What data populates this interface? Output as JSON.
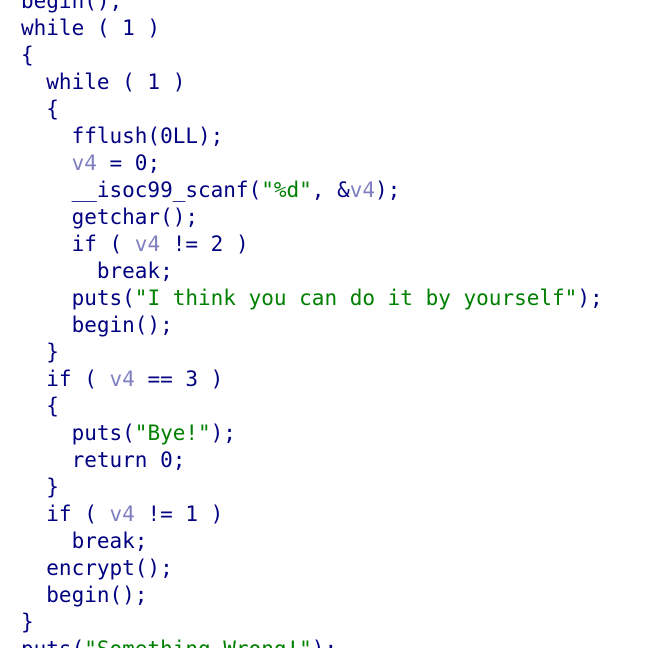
{
  "editor": {
    "lines": [
      [
        {
          "t": "code",
          "s": "begin();"
        }
      ],
      [
        {
          "t": "code",
          "s": "while ( 1 )"
        }
      ],
      [
        {
          "t": "code",
          "s": "{"
        }
      ],
      [
        {
          "t": "code",
          "s": "  while ( 1 )"
        }
      ],
      [
        {
          "t": "code",
          "s": "  {"
        }
      ],
      [
        {
          "t": "code",
          "s": "    fflush(0LL);"
        }
      ],
      [
        {
          "t": "code",
          "s": "    "
        },
        {
          "t": "var",
          "s": "v4"
        },
        {
          "t": "code",
          "s": " = 0;"
        }
      ],
      [
        {
          "t": "code",
          "s": "    __isoc99_scanf("
        },
        {
          "t": "str",
          "s": "\"%d\""
        },
        {
          "t": "code",
          "s": ", &"
        },
        {
          "t": "var",
          "s": "v4"
        },
        {
          "t": "code",
          "s": ");"
        }
      ],
      [
        {
          "t": "code",
          "s": "    getchar();"
        }
      ],
      [
        {
          "t": "code",
          "s": "    if ( "
        },
        {
          "t": "var",
          "s": "v4"
        },
        {
          "t": "code",
          "s": " != 2 )"
        }
      ],
      [
        {
          "t": "code",
          "s": "      break;"
        }
      ],
      [
        {
          "t": "code",
          "s": "    puts("
        },
        {
          "t": "str",
          "s": "\"I think you can do it by yourself\""
        },
        {
          "t": "code",
          "s": ");"
        }
      ],
      [
        {
          "t": "code",
          "s": "    begin();"
        }
      ],
      [
        {
          "t": "code",
          "s": "  }"
        }
      ],
      [
        {
          "t": "code",
          "s": "  if ( "
        },
        {
          "t": "var",
          "s": "v4"
        },
        {
          "t": "code",
          "s": " == 3 )"
        }
      ],
      [
        {
          "t": "code",
          "s": "  {"
        }
      ],
      [
        {
          "t": "code",
          "s": "    puts("
        },
        {
          "t": "str",
          "s": "\"Bye!\""
        },
        {
          "t": "code",
          "s": ");"
        }
      ],
      [
        {
          "t": "code",
          "s": "    return 0;"
        }
      ],
      [
        {
          "t": "code",
          "s": "  }"
        }
      ],
      [
        {
          "t": "code",
          "s": "  if ( "
        },
        {
          "t": "var",
          "s": "v4"
        },
        {
          "t": "code",
          "s": " != 1 )"
        }
      ],
      [
        {
          "t": "code",
          "s": "    break;"
        }
      ],
      [
        {
          "t": "code",
          "s": "  encrypt();"
        }
      ],
      [
        {
          "t": "code",
          "s": "  begin();"
        }
      ],
      [
        {
          "t": "code",
          "s": "}"
        }
      ],
      [
        {
          "t": "code",
          "s": "puts("
        },
        {
          "t": "str",
          "s": "\"Something Wrong!\""
        },
        {
          "t": "code",
          "s": ");"
        }
      ]
    ]
  },
  "colors": {
    "code": "#000080",
    "variable": "#8080c0",
    "string": "#008000",
    "background": "#ffffff"
  }
}
